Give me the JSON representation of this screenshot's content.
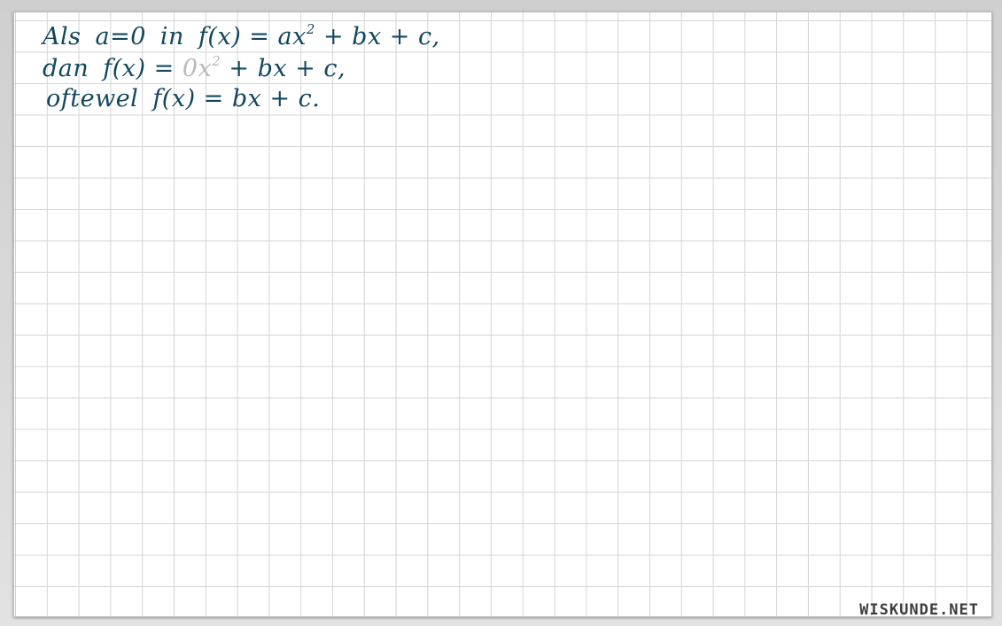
{
  "lines": [
    {
      "lead": "Als",
      "condition": "a=0",
      "connector": "in",
      "lhs": "f(x) = ax",
      "exp": "2",
      "rest": " + bx + c,"
    },
    {
      "lead": "dan",
      "lhs": "f(x) = ",
      "faded_term": "0x",
      "exp": "2",
      "rest": " + bx + c,"
    },
    {
      "lead": "oftewel",
      "lhs": "f(x) = bx + c."
    }
  ],
  "watermark": "WISKUNDE.NET",
  "colors": {
    "ink": "#12475e",
    "faded_ink": "#b9b9b9",
    "grid": "#d4d4d4"
  }
}
